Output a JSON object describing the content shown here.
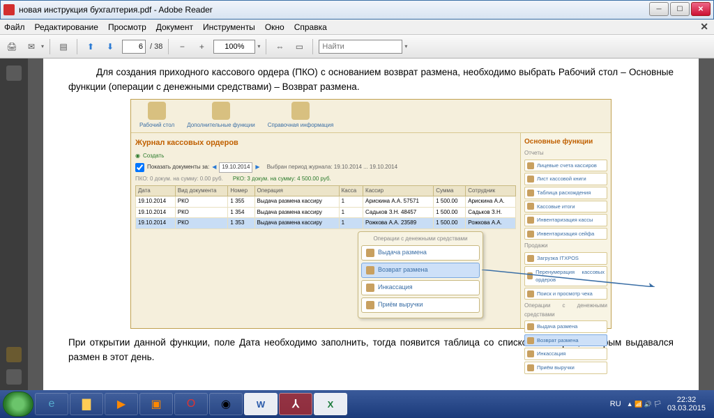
{
  "window": {
    "title": "новая инструкция бухгалтерия.pdf - Adobe Reader"
  },
  "menu": {
    "file": "Файл",
    "edit": "Редактирование",
    "view": "Просмотр",
    "doc": "Документ",
    "tools": "Инструменты",
    "window": "Окно",
    "help": "Справка"
  },
  "toolbar": {
    "page": "6",
    "pages": "/ 38",
    "zoom": "100%",
    "find_label": "Найти"
  },
  "doc": {
    "p1": "Для создания приходного кассового ордера (ПКО) с основанием возврат размена, необходимо выбрать Рабочий стол – Основные функции (операции с денежными средствами) – Возврат размена.",
    "p2": "При открытии данной функции, поле Дата необходимо заполнить, тогда появится таблица со списком кассиров, которым выдавался размен в этот день."
  },
  "emb": {
    "tb": [
      {
        "l": "Рабочий стол"
      },
      {
        "l": "Дополнительные функции"
      },
      {
        "l": "Справочная информация"
      }
    ],
    "title": "Журнал кассовых ордеров",
    "create": "Создать",
    "filter": "Показать документы за:",
    "date": "19.10.2014",
    "period": "Выбран период журнала: 19.10.2014 ... 19.10.2014",
    "sum1": "ПКО:   0 докум. на сумму: 0.00 руб.",
    "sum2": "РКО:   3 докум. на сумму: 4 500.00 руб.",
    "cols": [
      "Дата",
      "Вид документа",
      "Номер",
      "Операция",
      "Касса",
      "Кассир",
      "Сумма",
      "Сотрудник"
    ],
    "rows": [
      [
        "19.10.2014",
        "РКО",
        "1 355",
        "Выдача размена кассиру",
        "1",
        "Арискина А.А. 57571",
        "1 500.00",
        "Арискина А.А."
      ],
      [
        "19.10.2014",
        "РКО",
        "1 354",
        "Выдача размена кассиру",
        "1",
        "Садьков З.Н. 48457",
        "1 500.00",
        "Садьков З.Н."
      ],
      [
        "19.10.2014",
        "РКО",
        "1 353",
        "Выдача размена кассиру",
        "1",
        "Рожкова А.А. 23589",
        "1 500.00",
        "Рожкова А.А."
      ]
    ],
    "popup": {
      "title": "Операции с денежными средствами",
      "items": [
        "Выдача размена",
        "Возврат размена",
        "Инкассация",
        "Приём выручки"
      ]
    },
    "right": {
      "title": "Основные функции",
      "s1": "Отчеты",
      "g1": [
        "Лицевые счета кассиров",
        "Лист кассовой книги",
        "Таблица расхождения",
        "Кассовые итоги",
        "Инвентаризация кассы",
        "Инвентаризация сейфа"
      ],
      "s2": "Продажи",
      "g2": [
        "Загрузка ITXPOS",
        "Перенумерация кассовых ордеров",
        "Поиск и просмотр чека"
      ],
      "s3": "Операции с денежными средствами",
      "g3": [
        "Выдача размена",
        "Возврат размена",
        "Инкассация",
        "Приём выручки"
      ]
    }
  },
  "taskbar": {
    "lang": "RU",
    "time": "22:32",
    "date": "03.03.2015"
  }
}
